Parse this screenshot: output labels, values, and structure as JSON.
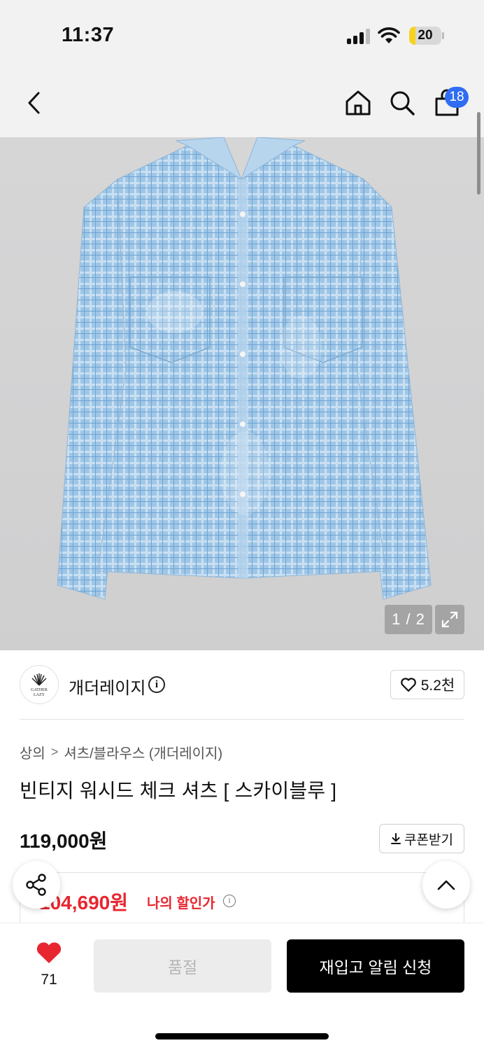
{
  "status_bar": {
    "time": "11:37",
    "battery": "20",
    "battery_level": 0.2
  },
  "nav": {
    "back_icon": "chevron-left-icon",
    "home_icon": "home-icon",
    "search_icon": "search-icon",
    "cart_icon": "shopping-bag-icon",
    "cart_count": "18"
  },
  "gallery": {
    "counter": "1 / 2",
    "expand_icon": "expand-icon",
    "product_color": "#9fc6e6"
  },
  "brand": {
    "logo_text": "GATHER\nLAZY",
    "name": "개더레이지",
    "info_icon": "info-icon",
    "likes": "5.2천"
  },
  "breadcrumb": {
    "level1": "상의",
    "separator": ">",
    "level2": "셔츠/블라우스 (개더레이지)"
  },
  "product": {
    "title": "빈티지 워시드 체크 셔츠 [ 스카이블루 ]",
    "price": "119,000원",
    "coupon_label": "쿠폰받기",
    "my_price": "104,690원",
    "my_price_label": "나의 할인가"
  },
  "bottom_bar": {
    "like_count": "71",
    "soldout_label": "품절",
    "restock_label": "재입고 알림 신청"
  },
  "colors": {
    "accent_red": "#e8262f",
    "badge_blue": "#2f6df2",
    "black": "#000000"
  }
}
